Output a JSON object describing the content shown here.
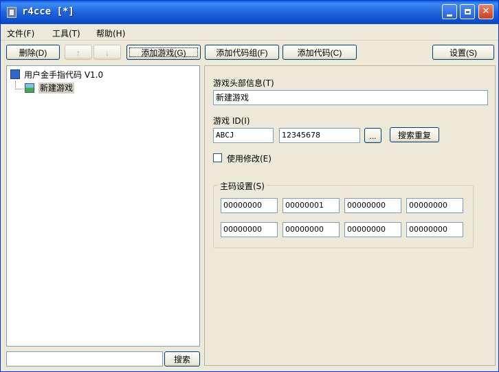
{
  "window": {
    "title": "r4cce [*]"
  },
  "menu": [
    {
      "label": "文件(F)"
    },
    {
      "label": "工具(T)"
    },
    {
      "label": "帮助(H)"
    }
  ],
  "toolbar": {
    "delete_label": "删除(D)",
    "up_label": "↑",
    "down_label": "↓",
    "add_game_label": "添加游戏(G)",
    "add_code_group_label": "添加代码组(F)",
    "add_code_label": "添加代码(C)",
    "settings_label": "设置(S)"
  },
  "tree": {
    "root_label": "用户金手指代码 V1.0",
    "child_label": "新建游戏"
  },
  "search": {
    "button_label": "搜索",
    "value": ""
  },
  "form": {
    "header_label": "游戏头部信息(T)",
    "header_value": "新建游戏",
    "game_id_label": "游戏 ID(I)",
    "game_id_code": "ABCJ",
    "game_id_hex": "12345678",
    "browse_label": "...",
    "search_dup_label": "搜索重复",
    "use_modify_label": "使用修改(E)",
    "master_code_label": "主码设置(S)",
    "master_codes": [
      [
        "00000000",
        "00000001",
        "00000000",
        "00000000"
      ],
      [
        "00000000",
        "00000000",
        "00000000",
        "00000000"
      ]
    ]
  },
  "colors": {
    "titlebar": "#0b4fd0",
    "window_bg": "#ece9d8",
    "close_button": "#c9401f"
  }
}
